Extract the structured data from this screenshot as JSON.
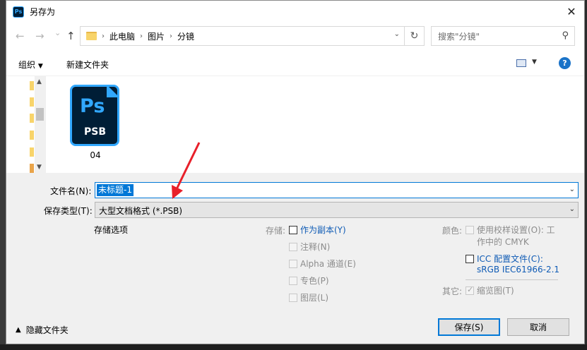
{
  "titlebar": {
    "app_icon": "ps-icon",
    "title": "另存为",
    "close": "✕"
  },
  "nav": {
    "back": "←",
    "forward": "→",
    "recent": "⌄",
    "up": "↑",
    "breadcrumb": [
      "此电脑",
      "图片",
      "分镜"
    ],
    "refresh": "↻",
    "search_placeholder": "搜索\"分镜\""
  },
  "toolbar": {
    "organize": "组织",
    "new_folder": "新建文件夹",
    "help": "?"
  },
  "files": [
    {
      "name": "04",
      "icon_text": "Ps",
      "type_label": "PSB"
    }
  ],
  "form": {
    "filename_label": "文件名(N):",
    "filename_value": "未标题-1",
    "filetype_label": "保存类型(T):",
    "filetype_value": "大型文档格式 (*.PSB)"
  },
  "options": {
    "section_title": "存储选项",
    "save_label": "存储:",
    "as_copy": "作为副本(Y)",
    "notes": "注释(N)",
    "alpha": "Alpha 通道(E)",
    "spot": "专色(P)",
    "layers": "图层(L)",
    "color_label": "颜色:",
    "proof_line1": "使用校样设置(O): 工",
    "proof_line2": "作中的 CMYK",
    "icc_line1": "ICC 配置文件(C):",
    "icc_line2": "sRGB IEC61966-2.1",
    "other_label": "其它:",
    "thumbnail": "缩览图(T)"
  },
  "footer": {
    "hide_folders": "隐藏文件夹",
    "save": "保存(S)",
    "cancel": "取消"
  },
  "colors": {
    "accent": "#0078d7",
    "ps_bg": "#001e36",
    "ps_blue": "#31a8ff",
    "annotation": "#e8202a"
  }
}
